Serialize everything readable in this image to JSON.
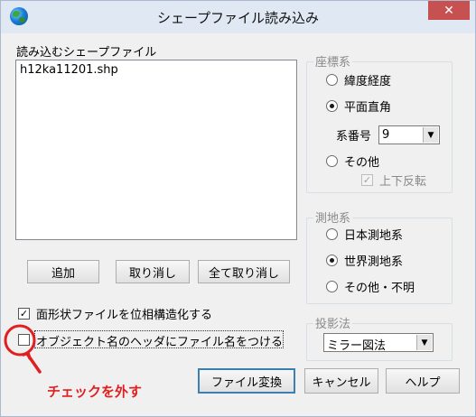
{
  "window": {
    "title": "シェープファイル読み込み",
    "close_symbol": "✕"
  },
  "file_list": {
    "label": "読み込むシェープファイル",
    "items": [
      "h12ka11201.shp"
    ]
  },
  "coordinate_system": {
    "title": "座標系",
    "options": [
      {
        "label": "緯度経度",
        "selected": false
      },
      {
        "label": "平面直角",
        "selected": true
      },
      {
        "label": "その他",
        "selected": false
      }
    ],
    "zone_label": "系番号",
    "zone_value": "9",
    "flip_label": "上下反転",
    "flip_checked": true
  },
  "datum": {
    "title": "測地系",
    "options": [
      {
        "label": "日本測地系",
        "selected": false
      },
      {
        "label": "世界測地系",
        "selected": true
      },
      {
        "label": "その他・不明",
        "selected": false
      }
    ]
  },
  "list_buttons": {
    "add": "追加",
    "remove": "取り消し",
    "remove_all": "全て取り消し"
  },
  "options": {
    "topology_label": "面形状ファイルを位相構造化する",
    "topology_checked": true,
    "header_label": "オブジェクト名のヘッダにファイル名をつける",
    "header_checked": false
  },
  "projection": {
    "title": "投影法",
    "value": "ミラー図法"
  },
  "actions": {
    "convert": "ファイル変換",
    "cancel": "キャンセル",
    "help": "ヘルプ"
  },
  "annotation": {
    "text": "チェックを外す",
    "color": "#e02020"
  }
}
